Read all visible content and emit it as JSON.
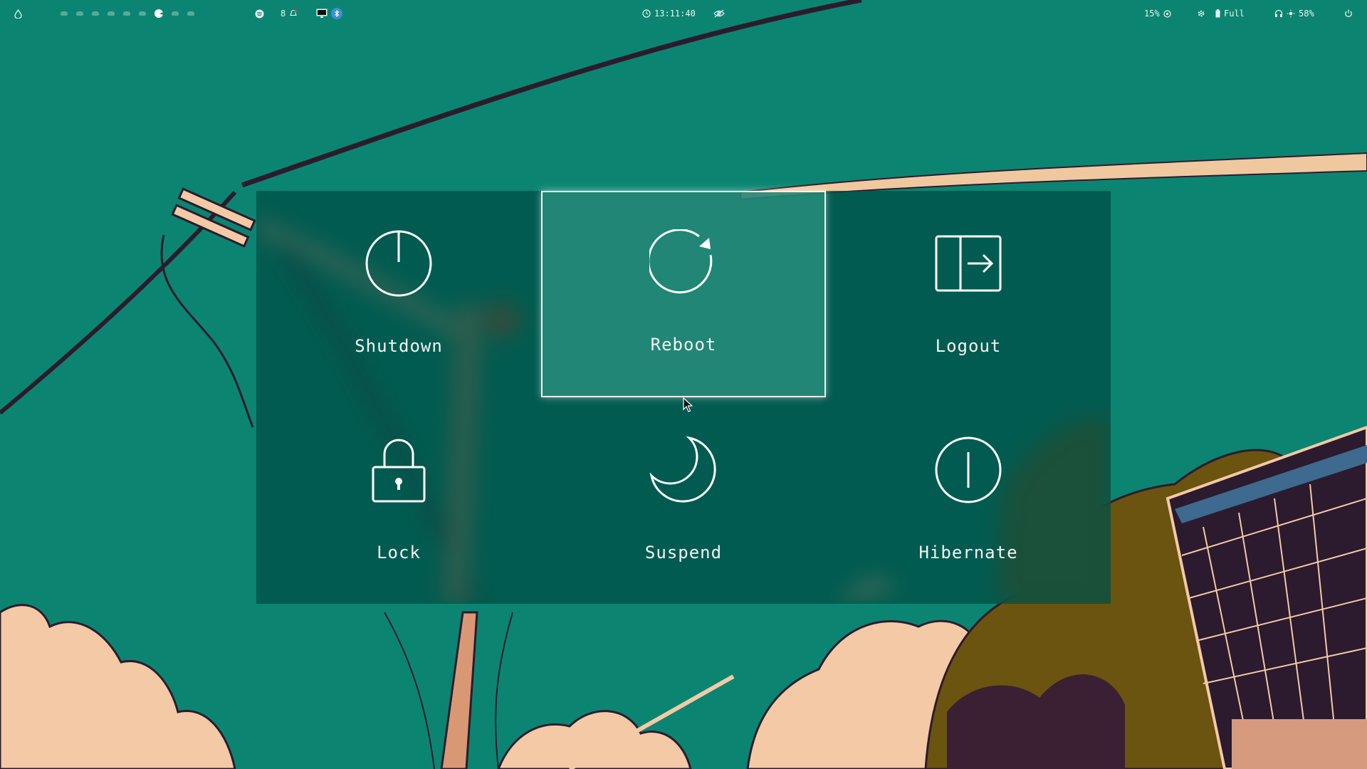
{
  "topbar": {
    "launcher_icon": "drop-icon",
    "workspace_count": 9,
    "active_workspace_index": 6,
    "music_icon": "spotify-icon",
    "notification_count": "8",
    "notification_icon": "bell-icon",
    "tray_icons": [
      "screen-icon",
      "bluetooth-icon"
    ],
    "clock_icon": "clock-icon",
    "clock": "13:11:40",
    "idle_icon": "eye-off-icon",
    "cpu_value": "15%",
    "cpu_icon": "cpu-icon",
    "settings_icon": "gear-icon",
    "battery_status": "Full",
    "battery_icon": "battery-icon",
    "headset_icon": "headset-icon",
    "brightness_icon": "brightness-icon",
    "brightness_value": "58%",
    "power_icon": "power-icon"
  },
  "power_menu": {
    "options": [
      {
        "label": "Shutdown",
        "icon": "shutdown-icon"
      },
      {
        "label": "Reboot",
        "icon": "reboot-icon",
        "selected": true
      },
      {
        "label": "Logout",
        "icon": "logout-icon"
      },
      {
        "label": "Lock",
        "icon": "lock-icon"
      },
      {
        "label": "Suspend",
        "icon": "suspend-icon"
      },
      {
        "label": "Hibernate",
        "icon": "hibernate-icon"
      }
    ]
  },
  "colors": {
    "sky": "#0b8572",
    "menu_background": "#005046",
    "selected_background": "#3caa96",
    "text": "#ffffff"
  }
}
